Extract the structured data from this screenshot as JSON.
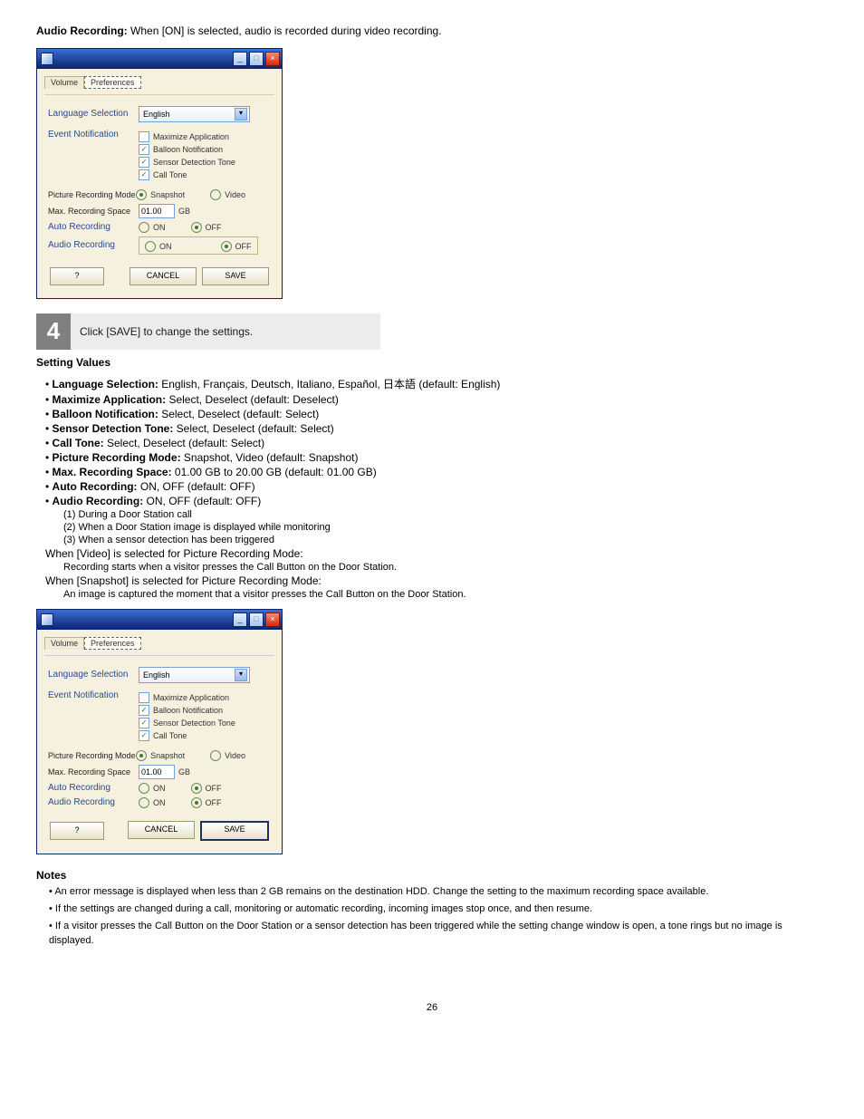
{
  "doc": {
    "title": "Audio Recording:",
    "title_desc": "When [ON] is selected, audio is recorded during video recording.",
    "setting_values_label": "Setting Values",
    "bullets": [
      {
        "k": "Language Selection:",
        "v": "English, Français, Deutsch, Italiano, Español, 日本語 (default: English)"
      },
      {
        "k": "Maximize Application:",
        "v": "Select, Deselect (default: Deselect)"
      },
      {
        "k": "Balloon Notification:",
        "v": "Select, Deselect (default: Select)"
      },
      {
        "k": "Sensor Detection Tone:",
        "v": "Select, Deselect (default: Select)"
      },
      {
        "k": "Call Tone:",
        "v": "Select, Deselect (default: Select)"
      },
      {
        "k": "Picture Recording Mode:",
        "v": "Snapshot, Video (default: Snapshot)"
      },
      {
        "k": "Max. Recording Space:",
        "v": "01.00 GB to 20.00 GB (default: 01.00 GB)"
      },
      {
        "k": "Auto Recording:",
        "v": "ON, OFF (default: OFF)"
      },
      {
        "k": "Audio Recording:",
        "v": "ON, OFF (default: OFF)"
      }
    ],
    "sub1": "(1) During a Door Station call",
    "sub2": "(2) When a Door Station image is displayed while monitoring",
    "sub3": "(3) When a sensor detection has been triggered",
    "foot1": "When [Video] is selected for Picture Recording Mode:",
    "foot1sub": "Recording starts when a visitor presses the Call Button on the Door Station.",
    "foot2": "When [Snapshot] is selected for Picture Recording Mode:",
    "foot2sub": "An image is captured the moment that a visitor presses the Call Button on the Door Station."
  },
  "dialog": {
    "tabs": {
      "volume": "Volume",
      "prefs": "Preferences"
    },
    "lang_label": "Language Selection",
    "lang_value": "English",
    "event_label": "Event Notification",
    "chk_max": "Maximize Application",
    "chk_balloon": "Balloon Notification",
    "chk_sensor": "Sensor Detection Tone",
    "chk_call": "Call Tone",
    "prm_label": "Picture Recording Mode",
    "prm_snap": "Snapshot",
    "prm_video": "Video",
    "mrs_label": "Max. Recording Space",
    "mrs_value": "01.00",
    "mrs_unit": "GB",
    "auto_label": "Auto Recording",
    "audio_label": "Audio Recording",
    "on": "ON",
    "off": "OFF",
    "help": "?",
    "cancel": "CANCEL",
    "save": "SAVE"
  },
  "step": {
    "num": "4",
    "text": "Click [SAVE] to change the settings."
  },
  "notes": {
    "title": "Notes",
    "n1": "An error message is displayed when less than 2 GB remains on the destination HDD. Change the setting to the maximum recording space available.",
    "n2": "If the settings are changed during a call, monitoring or automatic recording, incoming images stop once, and then resume.",
    "n3": "If a visitor presses the Call Button on the Door Station or a sensor detection has been triggered while the setting change window is open, a tone rings but no image is displayed."
  },
  "page": "26"
}
